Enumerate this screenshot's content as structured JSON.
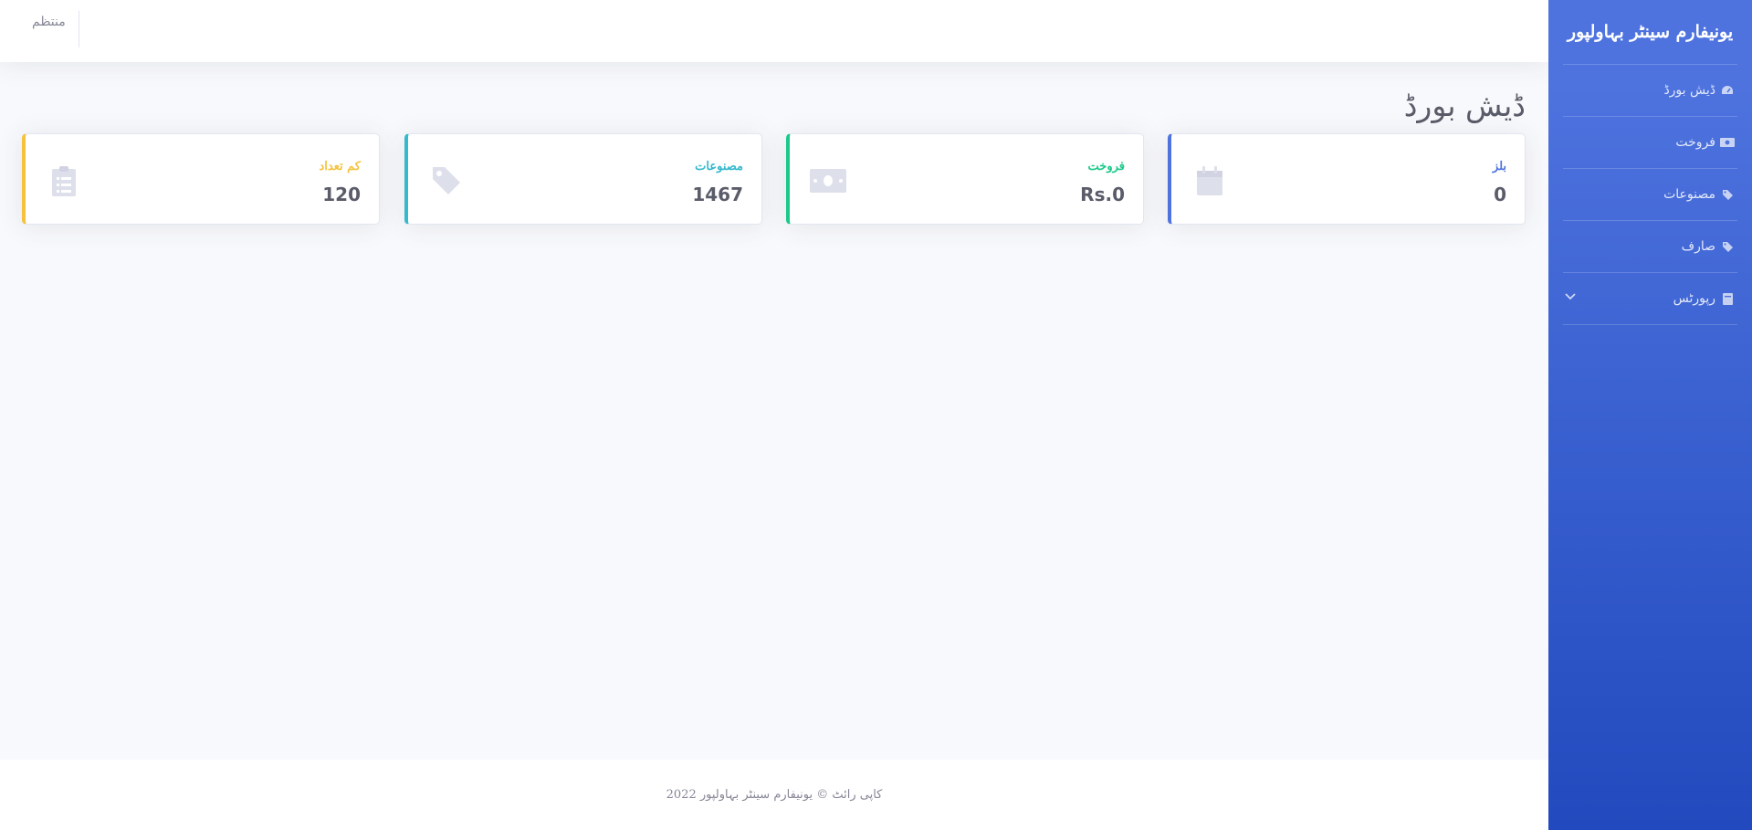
{
  "sidebar": {
    "brand": "یونیفارم سینٹر بہاولپور",
    "items": [
      {
        "label": "ڈیش بورڈ",
        "icon": "tachometer-icon"
      },
      {
        "label": "فروخت",
        "icon": "money-bill-icon"
      },
      {
        "label": "مصنوعات",
        "icon": "tag-icon"
      },
      {
        "label": "صارف",
        "icon": "tag-icon"
      },
      {
        "label": "رپورٹس",
        "icon": "book-icon",
        "expandable": true
      }
    ]
  },
  "topbar": {
    "user_label": "منتظم"
  },
  "page": {
    "title": "ڈیش بورڈ"
  },
  "cards": [
    {
      "label": "بلز",
      "value": "0",
      "accent": "#4e73df",
      "icon": "calendar-icon"
    },
    {
      "label": "فروخت",
      "value": "Rs.0",
      "accent": "#1cc88a",
      "icon": "money-bill-icon"
    },
    {
      "label": "مصنوعات",
      "value": "1467",
      "accent": "#36b9cc",
      "icon": "tag-icon"
    },
    {
      "label": "کم تعداد",
      "value": "120",
      "accent": "#f6c23e",
      "icon": "clipboard-list-icon"
    }
  ],
  "footer": {
    "copyright": "کاپی رائٹ © یونیفارم سینٹر بہاولپور 2022"
  }
}
